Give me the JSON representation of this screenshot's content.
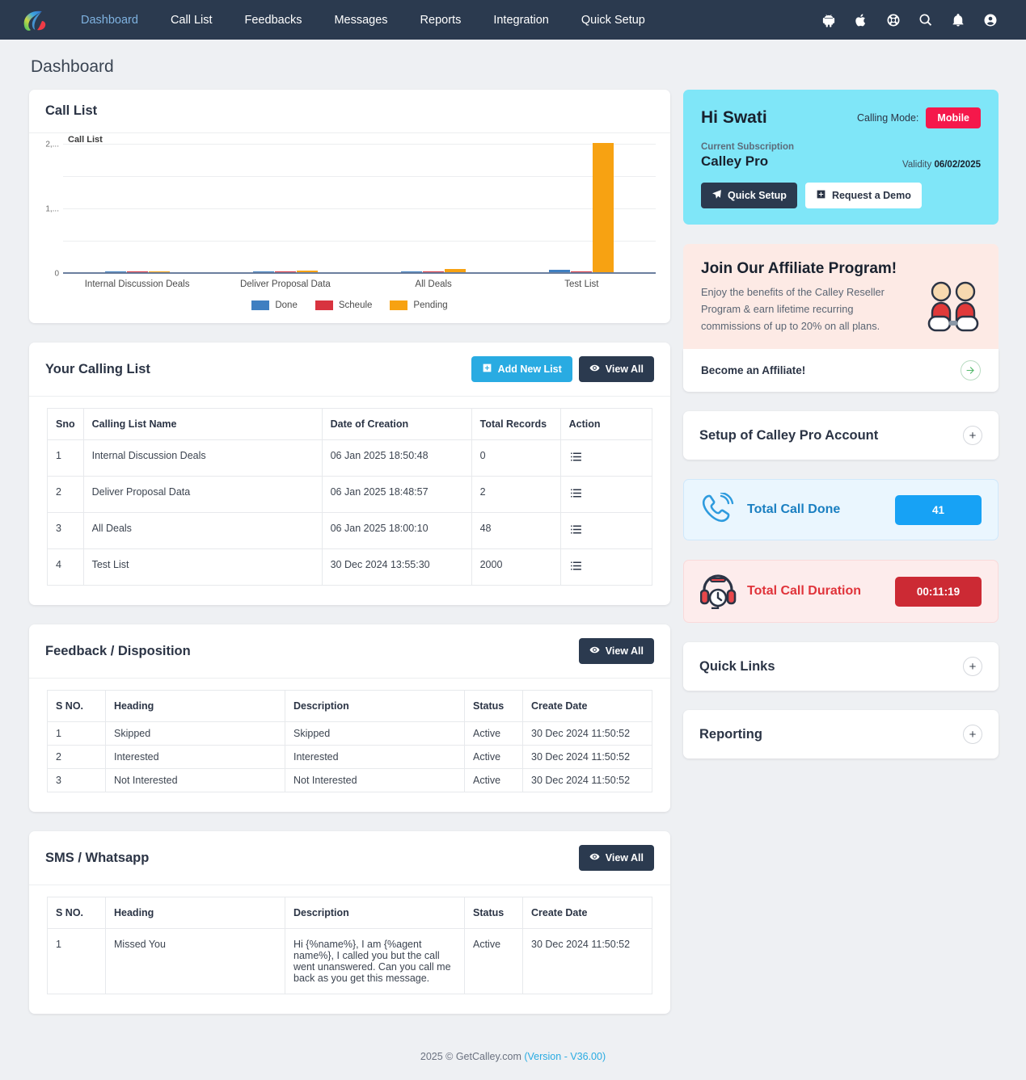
{
  "navbar": {
    "brand_icon": "calley-logo",
    "links": [
      {
        "label": "Dashboard",
        "active": true
      },
      {
        "label": "Call List",
        "active": false
      },
      {
        "label": "Feedbacks",
        "active": false
      },
      {
        "label": "Messages",
        "active": false
      },
      {
        "label": "Reports",
        "active": false
      },
      {
        "label": "Integration",
        "active": false
      },
      {
        "label": "Quick Setup",
        "active": false
      }
    ],
    "icons": [
      "android-icon",
      "apple-icon",
      "lifebuoy-support-icon",
      "search-icon",
      "bell-notification-icon",
      "user-account-icon"
    ]
  },
  "page": {
    "title": "Dashboard"
  },
  "call_list_card": {
    "title": "Call List"
  },
  "chart_data": {
    "type": "bar",
    "title": "Call List",
    "xlabel": "",
    "ylabel": "",
    "ylim": [
      0,
      2000
    ],
    "yticks": [
      0,
      1000,
      2000
    ],
    "ytick_labels": [
      "0",
      "1,...",
      "2,..."
    ],
    "grid": true,
    "legend_position": "bottom",
    "categories": [
      "Internal Discussion Deals",
      "Deliver Proposal Data",
      "All Deals",
      "Test List"
    ],
    "series": [
      {
        "name": "Done",
        "color": "#3f7fc1",
        "values": [
          0,
          0,
          0,
          41
        ]
      },
      {
        "name": "Scheule",
        "color": "#d8333f",
        "values": [
          0,
          0,
          0,
          0
        ]
      },
      {
        "name": "Pending",
        "color": "#f7a212",
        "values": [
          0,
          2,
          48,
          2000
        ]
      }
    ]
  },
  "calling_list": {
    "title": "Your Calling List",
    "add_label": "Add New List",
    "view_all_label": "View All",
    "columns": [
      "Sno",
      "Calling List Name",
      "Date of Creation",
      "Total Records",
      "Action"
    ],
    "rows": [
      {
        "sno": "1",
        "name": "Internal Discussion Deals",
        "date": "06 Jan 2025 18:50:48",
        "records": "0"
      },
      {
        "sno": "2",
        "name": "Deliver Proposal Data",
        "date": "06 Jan 2025 18:48:57",
        "records": "2"
      },
      {
        "sno": "3",
        "name": "All Deals",
        "date": "06 Jan 2025 18:00:10",
        "records": "48"
      },
      {
        "sno": "4",
        "name": "Test List",
        "date": "30 Dec 2024 13:55:30",
        "records": "2000"
      }
    ]
  },
  "feedback": {
    "title": "Feedback / Disposition",
    "view_all_label": "View All",
    "columns": [
      "S NO.",
      "Heading",
      "Description",
      "Status",
      "Create Date"
    ],
    "rows": [
      {
        "sno": "1",
        "heading": "Skipped",
        "description": "Skipped",
        "status": "Active",
        "date": "30 Dec 2024 11:50:52"
      },
      {
        "sno": "2",
        "heading": "Interested",
        "description": "Interested",
        "status": "Active",
        "date": "30 Dec 2024 11:50:52"
      },
      {
        "sno": "3",
        "heading": "Not Interested",
        "description": "Not Interested",
        "status": "Active",
        "date": "30 Dec 2024 11:50:52"
      }
    ]
  },
  "sms": {
    "title": "SMS / Whatsapp",
    "view_all_label": "View All",
    "columns": [
      "S NO.",
      "Heading",
      "Description",
      "Status",
      "Create Date"
    ],
    "rows": [
      {
        "sno": "1",
        "heading": "Missed You",
        "description": "Hi {%name%}, I am {%agent name%}, I called you but the call went unanswered. Can you call me back as you get this message.",
        "status": "Active",
        "date": "30 Dec 2024 11:50:52"
      }
    ]
  },
  "welcome": {
    "greeting": "Hi Swati",
    "calling_mode_label": "Calling Mode:",
    "calling_mode_value": "Mobile",
    "subscription_label": "Current Subscription",
    "plan": "Calley Pro",
    "validity_label": "Validity",
    "validity_value": "06/02/2025",
    "quick_setup_label": "Quick Setup",
    "request_demo_label": "Request a Demo"
  },
  "affiliate": {
    "title": "Join Our Affiliate Program!",
    "text": "Enjoy the benefits of the Calley Reseller Program & earn lifetime recurring commissions of up to 20% on all plans.",
    "cta": "Become an Affiliate!"
  },
  "accordions": [
    {
      "title": "Setup of Calley Pro Account"
    },
    {
      "title": "Quick Links"
    },
    {
      "title": "Reporting"
    }
  ],
  "stats": {
    "call_done": {
      "label": "Total Call Done",
      "value": "41"
    },
    "call_duration": {
      "label": "Total Call Duration",
      "value": "00:11:19"
    }
  },
  "footer": {
    "text": "2025 © GetCalley.com ",
    "version": "(Version - V36.00)"
  },
  "colors": {
    "navbar": "#2b3a4f",
    "accent_blue": "#29abe2",
    "welcome_bg": "#7fe6f8",
    "badge_red": "#f5184b",
    "affiliate_bg": "#fdeae5",
    "done": "#3f7fc1",
    "scheule": "#d8333f",
    "pending": "#f7a212"
  }
}
